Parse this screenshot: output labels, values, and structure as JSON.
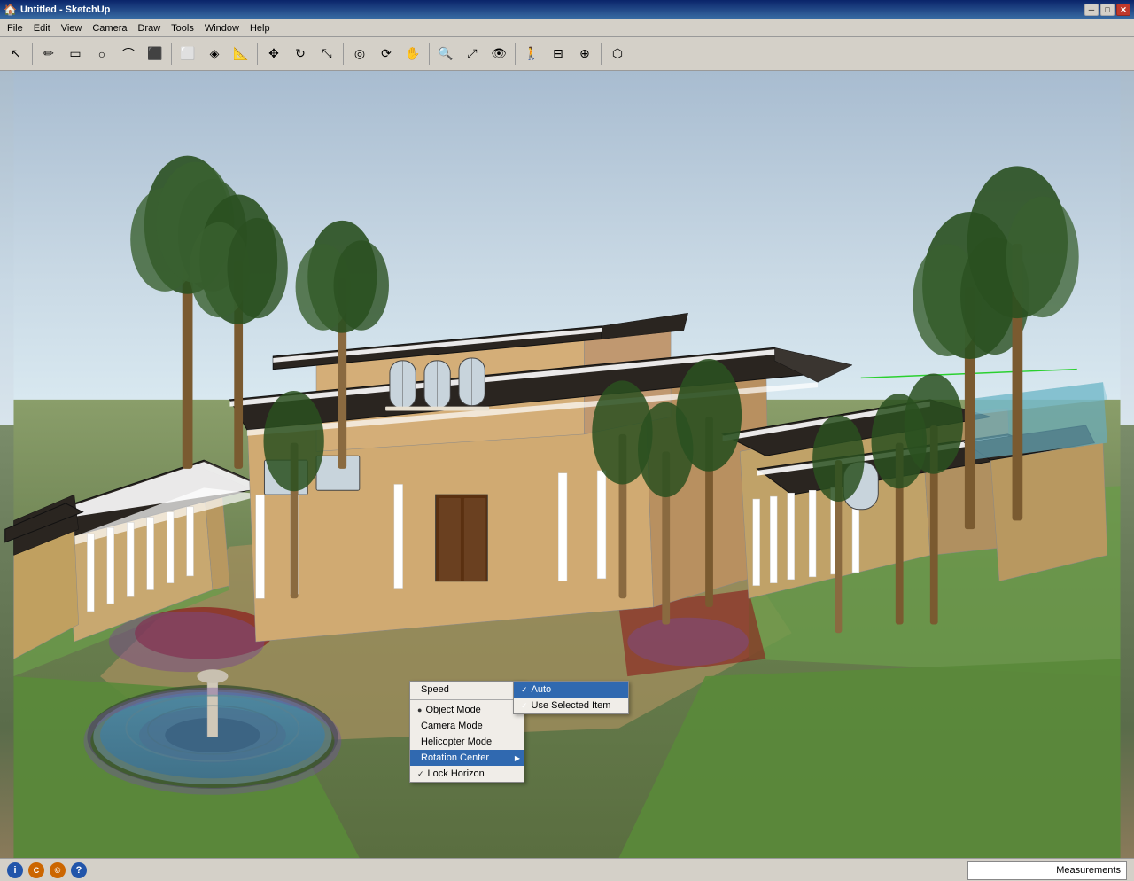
{
  "titlebar": {
    "title": "Untitled - SketchUp",
    "min_label": "─",
    "max_label": "□",
    "close_label": "✕"
  },
  "menubar": {
    "items": [
      "File",
      "Edit",
      "View",
      "Camera",
      "Draw",
      "Tools",
      "Window",
      "Help"
    ]
  },
  "toolbar": {
    "tools": [
      {
        "name": "select",
        "icon": "↖",
        "label": "Select"
      },
      {
        "name": "pencil",
        "icon": "✏",
        "label": "Pencil"
      },
      {
        "name": "rectangle",
        "icon": "▭",
        "label": "Rectangle"
      },
      {
        "name": "circle",
        "icon": "○",
        "label": "Circle"
      },
      {
        "name": "arc",
        "icon": "⌒",
        "label": "Arc"
      },
      {
        "name": "push-pull",
        "icon": "⊡",
        "label": "Push/Pull"
      },
      {
        "name": "eraser",
        "icon": "⌫",
        "label": "Eraser"
      },
      {
        "name": "paint",
        "icon": "🪣",
        "label": "Paint Bucket"
      },
      {
        "name": "measure",
        "icon": "📐",
        "label": "Measure"
      },
      {
        "name": "move",
        "icon": "✥",
        "label": "Move"
      },
      {
        "name": "rotate",
        "icon": "↻",
        "label": "Rotate"
      },
      {
        "name": "scale",
        "icon": "⤢",
        "label": "Scale"
      },
      {
        "name": "offset",
        "icon": "⊕",
        "label": "Offset"
      },
      {
        "name": "orbit",
        "icon": "⟳",
        "label": "Orbit"
      },
      {
        "name": "pan",
        "icon": "✋",
        "label": "Pan"
      },
      {
        "name": "zoom",
        "icon": "🔍",
        "label": "Zoom"
      },
      {
        "name": "zoom-fit",
        "icon": "⊞",
        "label": "Zoom Extents"
      },
      {
        "name": "look-around",
        "icon": "👁",
        "label": "Look Around"
      },
      {
        "name": "walk",
        "icon": "🚶",
        "label": "Walk"
      },
      {
        "name": "section",
        "icon": "⊟",
        "label": "Section Plane"
      },
      {
        "name": "axes",
        "icon": "⊕",
        "label": "Axes"
      },
      {
        "name": "component",
        "icon": "⬡",
        "label": "Component"
      }
    ]
  },
  "context_menu": {
    "items": [
      {
        "id": "speed",
        "label": "Speed",
        "has_sub": true,
        "dot": false,
        "check": false
      },
      {
        "id": "sep1",
        "type": "sep"
      },
      {
        "id": "object-mode",
        "label": "Object Mode",
        "dot": true,
        "check": false
      },
      {
        "id": "camera-mode",
        "label": "Camera Mode",
        "dot": false,
        "check": false
      },
      {
        "id": "helicopter-mode",
        "label": "Helicopter Mode",
        "dot": false,
        "check": false
      },
      {
        "id": "rotation-center",
        "label": "Rotation Center",
        "has_sub": true,
        "highlighted": true
      },
      {
        "id": "lock-horizon",
        "label": "Lock Horizon",
        "dot": false,
        "check": true
      }
    ],
    "submenu": {
      "items": [
        {
          "id": "auto",
          "label": "Auto",
          "check": true,
          "highlighted": true
        },
        {
          "id": "use-selected",
          "label": "Use Selected Item",
          "check": true,
          "highlighted": false
        }
      ]
    }
  },
  "statusbar": {
    "measurements_label": "Measurements",
    "icons": [
      "ⓘ",
      "©",
      "©",
      "?"
    ]
  }
}
